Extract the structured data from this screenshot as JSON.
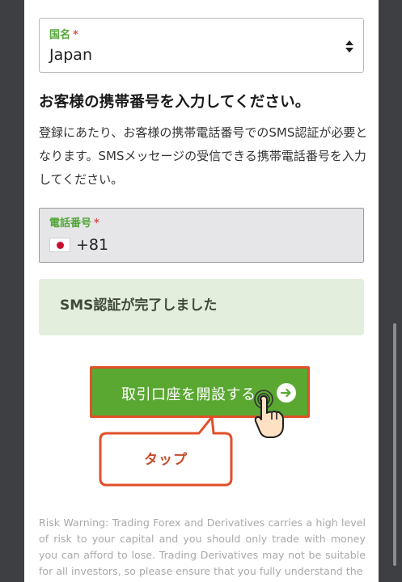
{
  "country_field": {
    "label": "国名",
    "required_mark": "*",
    "value": "Japan"
  },
  "phone_section": {
    "heading": "お客様の携帯番号を入力してください。",
    "description": "登録にあたり、お客様の携帯電話番号でのSMS認証が必要となります。SMSメッセージの受信できる携帯電話番号を入力してください。"
  },
  "phone_field": {
    "label": "電話番号",
    "required_mark": "*",
    "flag": "japan-flag-icon",
    "dial_code": "+81"
  },
  "sms_banner": {
    "text": "SMS認証が完了しました"
  },
  "open_account_button": {
    "label": "取引口座を開設する",
    "icon": "arrow-right-circle-icon"
  },
  "annotation": {
    "tap_label": "タップ",
    "icon": "pointing-hand-icon"
  },
  "risk_warning": "Risk Warning: Trading Forex and Derivatives carries a high level of risk to your capital and you should only trade with money you can afford to lose. Trading Derivatives may not be suitable for all investors, so please ensure that you fully understand the",
  "colors": {
    "accent_green": "#5aa832",
    "label_green": "#55a63a",
    "highlight_red": "#e0502a",
    "banner_bg": "#e3efdc",
    "outer_bg": "#3d3f43"
  }
}
